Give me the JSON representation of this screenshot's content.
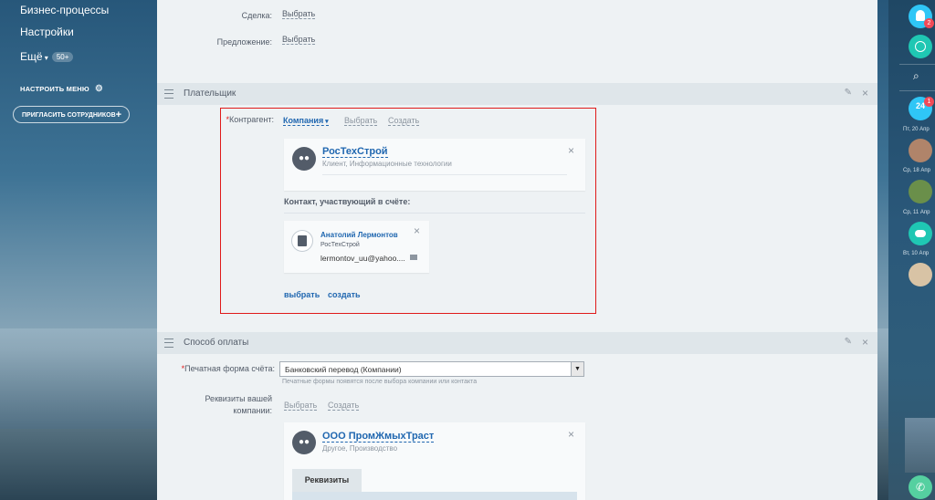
{
  "sidebar": {
    "items": [
      "Бизнес-процессы",
      "Настройки",
      "Ещё"
    ],
    "more_badge": "50+",
    "configure_menu": "НАСТРОИТЬ МЕНЮ",
    "invite": "ПРИГЛАСИТЬ СОТРУДНИКОВ"
  },
  "top_fields": {
    "deal_label": "Сделка:",
    "deal_value": "Выбрать",
    "offer_label": "Предложение:",
    "offer_value": "Выбрать"
  },
  "payer": {
    "section_title": "Плательщик",
    "counterparty_required": "*",
    "counterparty_label": "Контрагент:",
    "type": "Компания",
    "select": "Выбрать",
    "create": "Создать",
    "company_name": "РосТехСтрой",
    "company_sub": "Клиент, Информационные технологии",
    "contact_header": "Контакт, участвующий в счёте:",
    "contact_name": "Анатолий Лермонтов",
    "contact_company": "РосТехСтрой",
    "contact_email": "lermontov_uu@yahoo....",
    "choose": "выбрать",
    "create_lower": "создать"
  },
  "payment": {
    "section_title": "Способ оплаты",
    "print_form_required": "*",
    "print_form_label": "Печатная форма счёта:",
    "print_form_value": "Банковский перевод (Компании)",
    "print_form_hint": "Печатные формы появятся после выбора компании или контакта",
    "requisites_label_1": "Реквизиты вашей",
    "requisites_label_2": "компании:",
    "select": "Выбрать",
    "create": "Создать",
    "company_name": "ООО ПромЖмыхТраст",
    "company_sub": "Другое, Производство",
    "requisites_tab": "Реквизиты"
  },
  "rail": {
    "bitrix_badge": "1",
    "bitrix_label": "24",
    "notif_badge": "2",
    "dates": [
      "Пт, 20 Апр",
      "Ср, 18 Апр",
      "Ср, 11 Апр",
      "Вт, 10 Апр"
    ]
  },
  "colors": {
    "accent": "#2067b0",
    "highlight": "#e01a1a",
    "badge": "#f24a57",
    "rail_green": "#1fc7b3"
  }
}
